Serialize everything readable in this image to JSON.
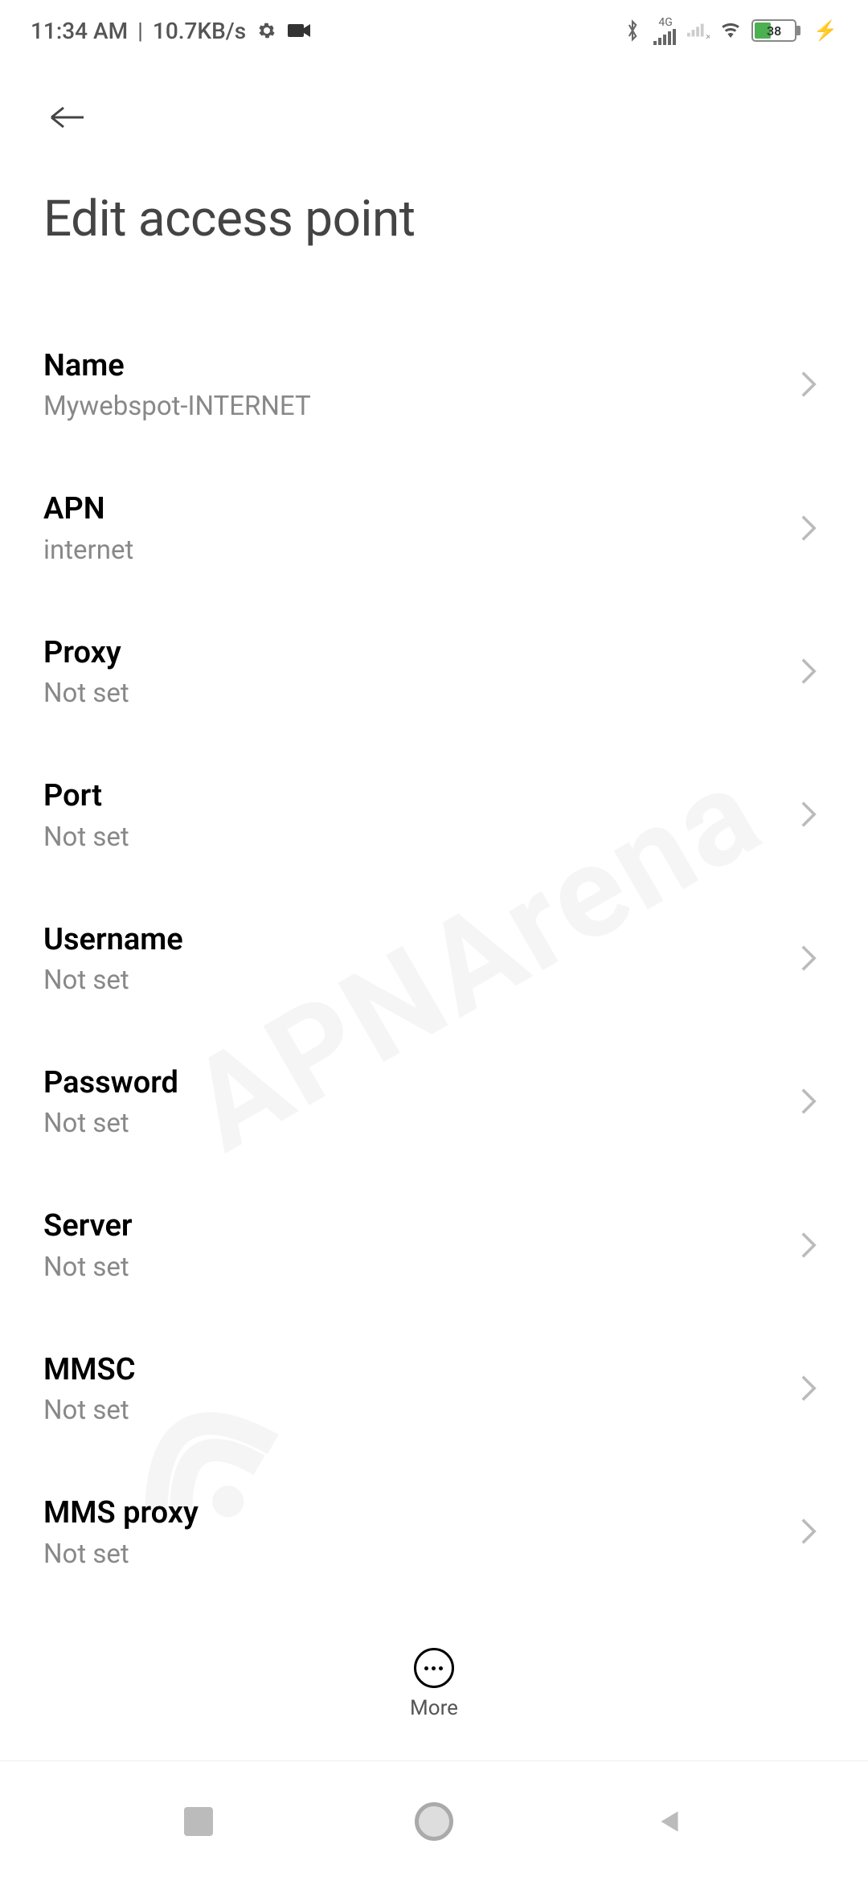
{
  "status_bar": {
    "time": "11:34 AM",
    "speed": "10.7KB/s",
    "battery_percent": "38",
    "network_label": "4G"
  },
  "header": {
    "title": "Edit access point"
  },
  "settings": [
    {
      "label": "Name",
      "value": "Mywebspot-INTERNET"
    },
    {
      "label": "APN",
      "value": "internet"
    },
    {
      "label": "Proxy",
      "value": "Not set"
    },
    {
      "label": "Port",
      "value": "Not set"
    },
    {
      "label": "Username",
      "value": "Not set"
    },
    {
      "label": "Password",
      "value": "Not set"
    },
    {
      "label": "Server",
      "value": "Not set"
    },
    {
      "label": "MMSC",
      "value": "Not set"
    },
    {
      "label": "MMS proxy",
      "value": "Not set"
    }
  ],
  "bottom": {
    "more_label": "More"
  },
  "watermark": "APNArena"
}
